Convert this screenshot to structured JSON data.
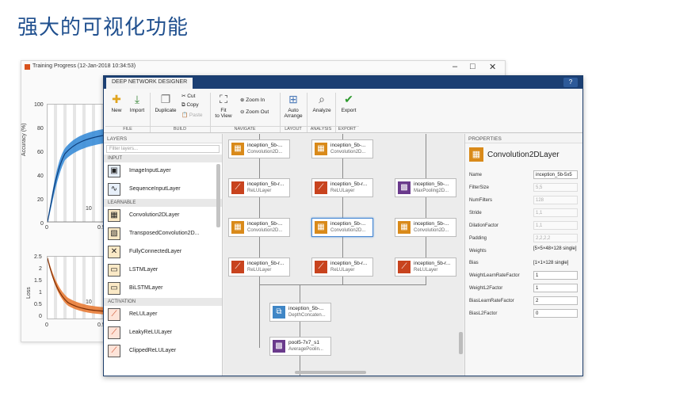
{
  "slide": {
    "title": "强大的可视化功能"
  },
  "training_window": {
    "title": "Training Progress (12-Jan-2018 10:34:53)",
    "controls": {
      "minimize": "–",
      "maximize": "□",
      "close": "✕"
    },
    "accuracy_plot": {
      "ylabel": "Accuracy (%)",
      "yticks": [
        "100",
        "80",
        "60",
        "40",
        "20",
        "0"
      ],
      "xticks": [
        "0",
        "10",
        "0.5"
      ]
    },
    "loss_plot": {
      "ylabel": "Loss",
      "yticks": [
        "2.5",
        "2",
        "1.5",
        "1",
        "0.5",
        "0"
      ],
      "xticks": [
        "0",
        "10",
        "0.5"
      ]
    }
  },
  "designer": {
    "tab": "DEEP NETWORK DESIGNER",
    "help": "?",
    "toolstrip": {
      "new": "New",
      "import": "Import",
      "duplicate": "Duplicate",
      "cut": "Cut",
      "copy": "Copy",
      "paste": "Paste",
      "fit_line1": "Fit",
      "fit_line2": "to View",
      "zoom_in": "Zoom In",
      "zoom_out": "Zoom Out",
      "arrange_line1": "Auto",
      "arrange_line2": "Arrange",
      "analyze": "Analyze",
      "export": "Export",
      "sections": {
        "file": "FILE",
        "build": "BUILD",
        "navigate": "NAVIGATE",
        "layout": "LAYOUT",
        "analysis": "ANALYSIS",
        "export": "EXPORT"
      }
    },
    "layers_panel": {
      "header": "LAYERS",
      "filter_placeholder": "Filter layers...",
      "cat_input": "INPUT",
      "cat_learnable": "LEARNABLE",
      "cat_activation": "ACTIVATION",
      "items": [
        "ImageInputLayer",
        "SequenceInputLayer",
        "Convolution2DLayer",
        "TransposedConvolution2D...",
        "FullyConnectedLayer",
        "LSTMLayer",
        "BiLSTMLayer",
        "ReLULayer",
        "LeakyReLULayer",
        "ClippedReLULayer"
      ]
    },
    "canvas": {
      "nodes": [
        {
          "name": "inception_5b-...",
          "type": "Convolution2D..."
        },
        {
          "name": "inception_5b-...",
          "type": "Convolution2D..."
        },
        {
          "name": "inception_5b-r...",
          "type": "ReLULayer"
        },
        {
          "name": "inception_5b-r...",
          "type": "ReLULayer"
        },
        {
          "name": "inception_5b-...",
          "type": "MaxPooling2D..."
        },
        {
          "name": "inception_5b-...",
          "type": "Convolution2D..."
        },
        {
          "name": "inception_5b-...",
          "type": "Convolution2D..."
        },
        {
          "name": "inception_5b-...",
          "type": "Convolution2D..."
        },
        {
          "name": "inception_5b-r...",
          "type": "ReLULayer"
        },
        {
          "name": "inception_5b-r...",
          "type": "ReLULayer"
        },
        {
          "name": "inception_5b-r...",
          "type": "ReLULayer"
        },
        {
          "name": "inception_5b-...",
          "type": "DepthConcaten..."
        },
        {
          "name": "pool5-7x7_s1",
          "type": "AveragePoolin..."
        }
      ]
    },
    "properties": {
      "header": "PROPERTIES",
      "layer_type": "Convolution2DLayer",
      "fields": {
        "name": {
          "label": "Name",
          "value": "inception_5b-5x5"
        },
        "filter_size": {
          "label": "FilterSize",
          "value": "5,5"
        },
        "num_filters": {
          "label": "NumFilters",
          "value": "128"
        },
        "stride": {
          "label": "Stride",
          "value": "1,1"
        },
        "dilation": {
          "label": "DilationFactor",
          "value": "1,1"
        },
        "padding": {
          "label": "Padding",
          "value": "2,2,2,2"
        },
        "weights": {
          "label": "Weights",
          "value": "[5×5×48×128 single]"
        },
        "bias": {
          "label": "Bias",
          "value": "[1×1×128 single]"
        },
        "wlrf": {
          "label": "WeightLearnRateFactor",
          "value": "1"
        },
        "wl2": {
          "label": "WeightL2Factor",
          "value": "1"
        },
        "blrf": {
          "label": "BiasLearnRateFactor",
          "value": "2"
        },
        "bl2": {
          "label": "BiasL2Factor",
          "value": "0"
        }
      }
    }
  },
  "colors": {
    "title_blue": "#1f4f8e",
    "header_navy": "#1b3f73",
    "conv_orange": "#d98a1a",
    "relu_red": "#c8431e",
    "pool_purple": "#6a3a8c",
    "concat_blue": "#3f86c6",
    "acc_blue": "#2e86d6",
    "loss_orange": "#e8742a"
  }
}
